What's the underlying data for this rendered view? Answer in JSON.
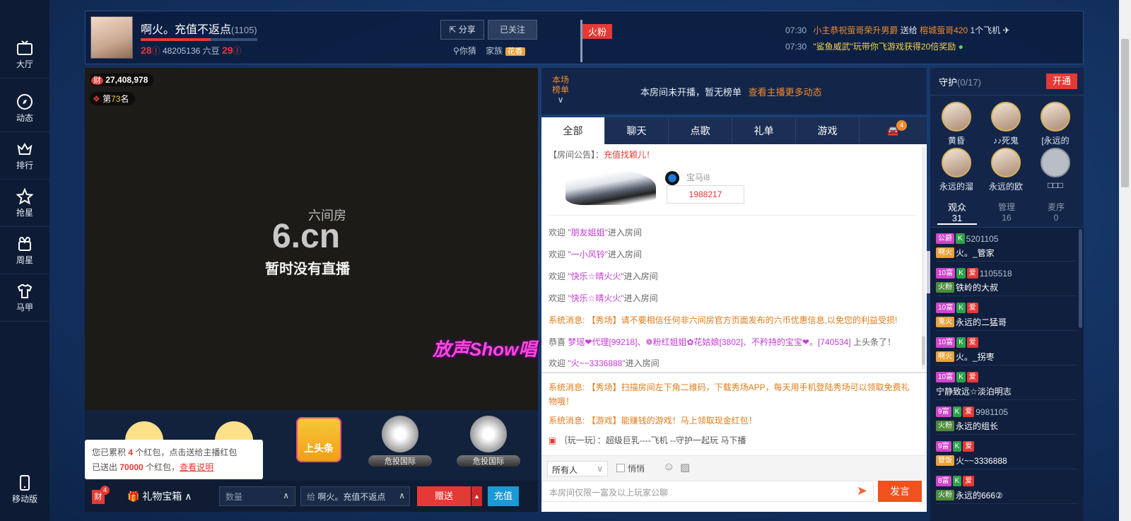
{
  "nav": {
    "items": [
      {
        "label": "大厅",
        "icon": "tv-icon"
      },
      {
        "label": "动态",
        "icon": "compass-icon"
      },
      {
        "label": "排行",
        "icon": "crown-icon"
      },
      {
        "label": "抢星",
        "icon": "star-icon"
      },
      {
        "label": "周星",
        "icon": "gift-icon"
      },
      {
        "label": "马甲",
        "icon": "shirt-icon"
      }
    ],
    "mobile": "移动版"
  },
  "header": {
    "title": "啊火。充值不返点",
    "count": "(1105)",
    "level_left": "28",
    "beans": "48205136 六豆",
    "level_right": "29",
    "share": "分享",
    "follow": "已关注",
    "location": "你猜",
    "family_label": "家族",
    "family_tag": "花香",
    "fans_flag": "火粉",
    "notices": [
      {
        "time": "07:30",
        "text": "小主恭祝萤哥荣升男爵",
        "action": "送给",
        "target": "榕城萤哥420",
        "gift": "1个飞机"
      },
      {
        "time": "07:30",
        "text": "\"鲨鱼威武\"玩带你飞游戏获得20倍奖励"
      }
    ]
  },
  "video": {
    "wealth": "27,408,978",
    "rank_prefix": "第",
    "rank_num": "73",
    "rank_suffix": "名",
    "logo_sub": "六间房",
    "logo_main": "6.cn",
    "status": "暂时没有直播",
    "show_logo": "放声Show唱"
  },
  "gifts": {
    "headline": "上头条",
    "items": [
      "危投国际",
      "危投国际"
    ],
    "tooltip_l1a": "您已累积",
    "tooltip_count": "4",
    "tooltip_l1b": "个红包，点击送给主播红包",
    "tooltip_l2a": "已送出",
    "tooltip_sent": "70000",
    "tooltip_l2b": "个红包，",
    "tooltip_link": "查看说明"
  },
  "bottom": {
    "cai": "财",
    "cai_badge": "4",
    "box": "礼物宝箱",
    "qty_placeholder": "数量",
    "give_prefix": "给",
    "give_name": "啊火。充值不返点",
    "send": "赠送",
    "recharge": "充值"
  },
  "rank": {
    "label1": "本场",
    "label2": "榜单",
    "msg": "本房间未开播，暂无榜单",
    "link": "查看主播更多动态"
  },
  "chat": {
    "tabs": [
      "全部",
      "聊天",
      "点歌",
      "礼单",
      "游戏"
    ],
    "car_badge": "4",
    "notice_label": "【房间公告】：",
    "notice_text": "充值找颖儿！",
    "car_name": "宝马i8",
    "car_id": "1988217",
    "messages": [
      {
        "type": "welcome",
        "pre": "欢迎 ",
        "name": "\"朋友姐姐\"",
        "post": "进入房间"
      },
      {
        "type": "welcome",
        "pre": "欢迎 ",
        "name": "\"一小风铃\"",
        "post": "进入房间"
      },
      {
        "type": "welcome",
        "pre": "欢迎 ",
        "name": "\"快乐☆晴火火\"",
        "post": "进入房间"
      },
      {
        "type": "welcome",
        "pre": "欢迎 ",
        "name": "\"快乐☆晴火火\"",
        "post": "进入房间"
      },
      {
        "type": "sys",
        "text": "系统消息: 【秀场】请不要相信任何非六间房官方页面发布的六币优惠信息,以免您的利益受损!"
      },
      {
        "type": "head",
        "pre": "恭喜 ",
        "text": "梦瑶❤代理[99218]、❁粉红姐姐✿花姑娘[3802]、不矜持的宝宝❤。[740534]",
        "post": " 上头条了！"
      },
      {
        "type": "welcome",
        "pre": "欢迎 ",
        "name": "\"火~~3336888\"",
        "post": "进入房间"
      }
    ],
    "sys2": "系统消息: 【秀场】扫描房间左下角二维码，下载秀场APP，每天用手机登陆秀场可以领取免费礼物哦！",
    "sys3": "系统消息: 【游戏】能赚钱的游戏！马上领取现金红包！",
    "play": "｛玩一玩｝：超级巨乳----飞机 --守护一起玩 马下播",
    "to": "所有人",
    "whisper": "悄悄",
    "input_placeholder": "本房间仅限一富及以上玩家公聊",
    "send": "发言"
  },
  "guard": {
    "title": "守护",
    "count": "(0/17)",
    "open": "开通",
    "members": [
      "黄昏",
      "♪♪死鬼",
      "[永远的",
      "永远的溜",
      "永远的欧",
      "□□□"
    ]
  },
  "audience": {
    "tabs": [
      {
        "label": "观众",
        "count": "31"
      },
      {
        "label": "管理",
        "count": "16"
      },
      {
        "label": "麦序",
        "count": "0"
      }
    ],
    "rows": [
      {
        "lv": "公爵",
        "id": "5201105",
        "fan": "啊火",
        "name": "火。_管家"
      },
      {
        "lv": "10富",
        "id": "1105518",
        "fan": "火粉",
        "name": "铁岭的大叔"
      },
      {
        "lv": "10富",
        "id": "",
        "fan": "鬼火",
        "name": "永远的二猛哥"
      },
      {
        "lv": "10富",
        "id": "",
        "fan": "啊火",
        "name": "火。_拐枣"
      },
      {
        "lv": "10富",
        "id": "",
        "fan": "",
        "name": "宁静致远☆淡泊明志"
      },
      {
        "lv": "9富",
        "id": "9981105",
        "fan": "火粉",
        "name": "永远的组长"
      },
      {
        "lv": "9富",
        "id": "",
        "fan": "管饭",
        "name": "火~~3336888"
      },
      {
        "lv": "8富",
        "id": "",
        "fan": "火粉",
        "name": "永远的666②"
      }
    ]
  }
}
